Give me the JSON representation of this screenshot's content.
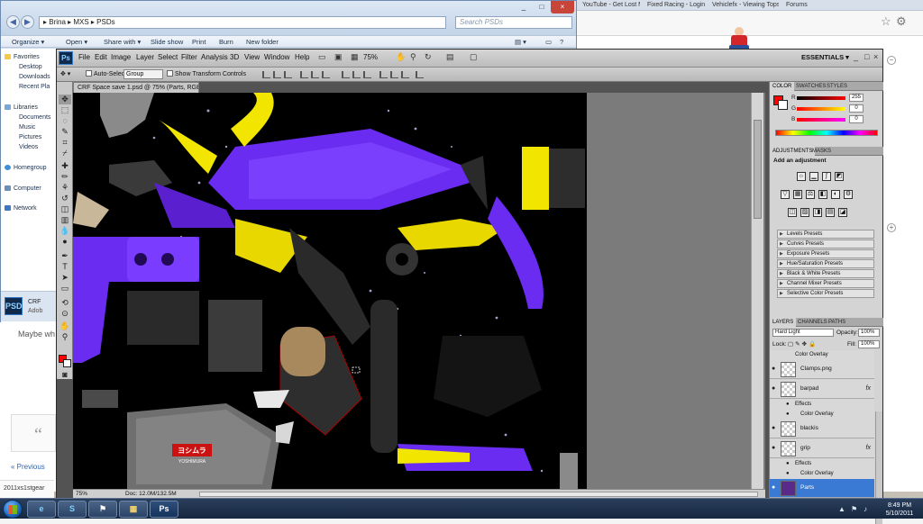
{
  "browser": {
    "tabs": [
      "Brina | MXS | PSDs",
      "YouTube - Get Lost Ma...",
      "Fixed Racing - Login",
      "Vehiclefx - Viewing Tops...",
      "Forums"
    ],
    "side_text": "Maybe wh",
    "prev_link": "« Previous",
    "page_number": "2011xs1stgear"
  },
  "explorer": {
    "window_controls": [
      "_",
      "□",
      "×"
    ],
    "breadcrumb": "▸ Brina ▸ MXS ▸ PSDs",
    "search_placeholder": "Search PSDs",
    "toolbar": [
      "Organize ▾",
      "Open ▾",
      "Share with ▾",
      "Slide show",
      "Print",
      "Burn",
      "New folder"
    ],
    "sidebar": {
      "favorites_header": "Favorites",
      "favorites": [
        "Desktop",
        "Downloads",
        "Recent Pla"
      ],
      "libraries_header": "Libraries",
      "libraries": [
        "Documents",
        "Music",
        "Pictures",
        "Videos"
      ],
      "homegroup": "Homegroup",
      "computer": "Computer",
      "network": "Network"
    },
    "status": {
      "name": "CRF",
      "type": "Adob",
      "icon_label": "PSD"
    }
  },
  "photoshop": {
    "logo": "Ps",
    "menu": [
      "File",
      "Edit",
      "Image",
      "Layer",
      "Select",
      "Filter",
      "Analysis",
      "3D",
      "View",
      "Window",
      "Help"
    ],
    "zoom": "75%",
    "workspace": "ESSENTIALS ▾",
    "options": {
      "auto_select_label": "Auto-Select:",
      "auto_select_value": "Group",
      "transform_label": "Show Transform Controls"
    },
    "document_tab": "CRF Space save 1.psd @ 75% (Parts, RGB/8#)",
    "status": {
      "zoom": "75%",
      "doc": "Doc: 12.0M/132.5M"
    },
    "canvas_logo": "ヨシムラ",
    "canvas_logo_sub": "YOSHIMURA"
  },
  "panels": {
    "color_tabs": [
      "COLOR",
      "SWATCHES",
      "STYLES"
    ],
    "color": {
      "r_label": "R",
      "g_label": "G",
      "b_label": "B",
      "r": "255",
      "g": "0",
      "b": "0"
    },
    "adjust_tabs": [
      "ADJUSTMENTS",
      "MASKS"
    ],
    "add_adjustment": "Add an adjustment",
    "presets": [
      "Levels Presets",
      "Curves Presets",
      "Exposure Presets",
      "Hue/Saturation Presets",
      "Black & White Presets",
      "Channel Mixer Presets",
      "Selective Color Presets"
    ],
    "layer_tabs": [
      "LAYERS",
      "CHANNELS",
      "PATHS"
    ],
    "blend_mode": "Hard Light",
    "opacity_label": "Opacity:",
    "opacity": "100%",
    "lock_label": "Lock:",
    "fill_label": "Fill:",
    "fill": "100%",
    "layers": [
      {
        "name": "Color Overlay",
        "kind": "sub"
      },
      {
        "name": "Clamps.png",
        "kind": "layer"
      },
      {
        "name": "barpad",
        "kind": "layer",
        "fx": "fx"
      },
      {
        "name": "Effects",
        "kind": "sub"
      },
      {
        "name": "Color Overlay",
        "kind": "sub"
      },
      {
        "name": "blackis",
        "kind": "layer"
      },
      {
        "name": "grip",
        "kind": "layer",
        "fx": "fx"
      },
      {
        "name": "Effects",
        "kind": "sub"
      },
      {
        "name": "Color Overlay",
        "kind": "sub"
      },
      {
        "name": "Parts",
        "kind": "layer",
        "selected": true
      }
    ]
  },
  "taskbar": {
    "items": [
      "e",
      "S",
      "⚑",
      "▦",
      "Ps"
    ],
    "time": "8:49 PM",
    "date": "5/10/2011"
  },
  "colors": {
    "accent_purple": "#6a2cf0",
    "accent_yellow": "#f2e600",
    "fg_red": "#ff0000",
    "selection_blue": "#3a7ad5"
  }
}
